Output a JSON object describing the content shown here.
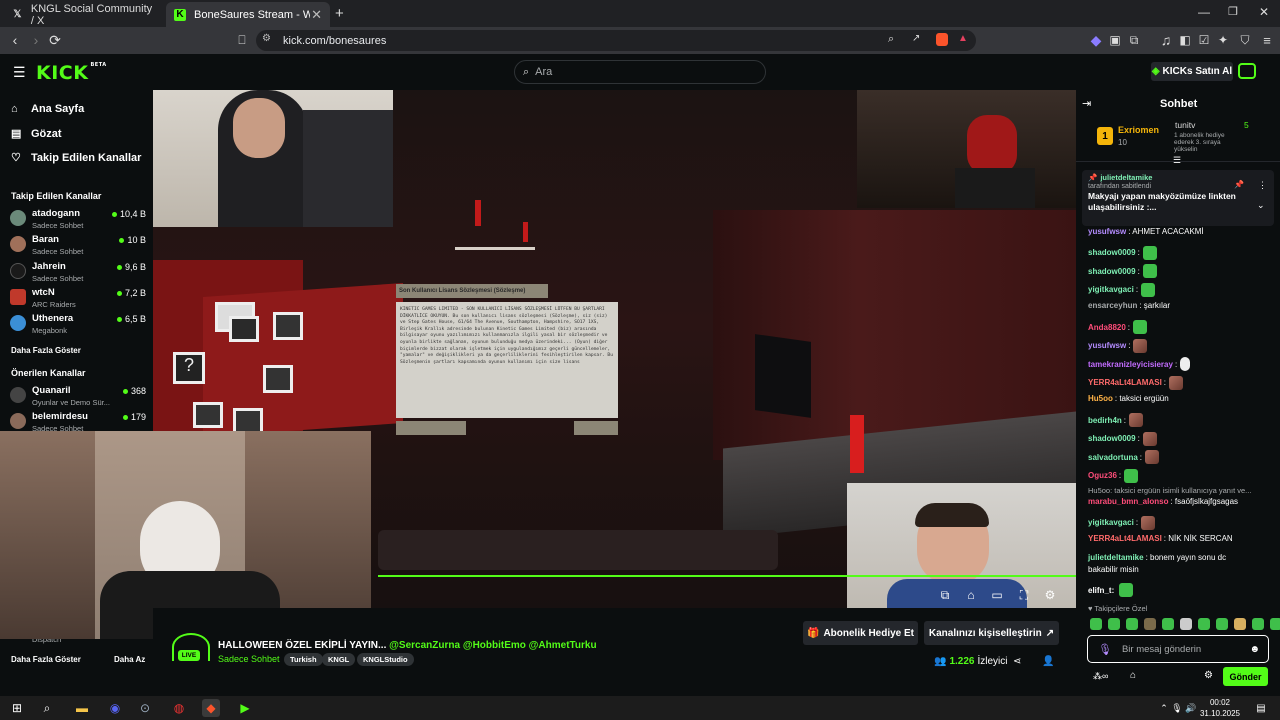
{
  "browser": {
    "tabs": [
      {
        "title": "KNGL Social Community / X",
        "icon": "x-logo-icon"
      },
      {
        "title": "BoneSaures Stream - Watch Live",
        "icon": "kick-logo-icon"
      }
    ],
    "url": "kick.com/bonesaures"
  },
  "header": {
    "logo": "KICK",
    "logo_badge": "BETA",
    "search_placeholder": "Ara",
    "buy_button": "KICKs Satın Al"
  },
  "sidebar": {
    "nav": [
      {
        "label": "Ana Sayfa",
        "icon": "home-icon"
      },
      {
        "label": "Gözat",
        "icon": "browse-icon"
      },
      {
        "label": "Takip Edilen Kanallar",
        "icon": "heart-icon"
      }
    ],
    "followed_title": "Takip Edilen Kanallar",
    "followed": [
      {
        "name": "atadogann",
        "sub": "Sadece Sohbet",
        "viewers": "10,4 B"
      },
      {
        "name": "Baran",
        "sub": "Sadece Sohbet",
        "viewers": "10 B"
      },
      {
        "name": "Jahrein",
        "sub": "Sadece Sohbet",
        "viewers": "9,6 B"
      },
      {
        "name": "wtcN",
        "sub": "ARC Raiders",
        "viewers": "7,2 B"
      },
      {
        "name": "Uthenera",
        "sub": "Megabonk",
        "viewers": "6,5 B"
      }
    ],
    "show_more": "Daha Fazla Göster",
    "recommended_title": "Önerilen Kanallar",
    "recommended": [
      {
        "name": "Quanaril",
        "sub": "Oyunlar ve Demo Sür...",
        "viewers": "368"
      },
      {
        "name": "belemirdesu",
        "sub": "Sadece Sohbet",
        "viewers": "179"
      }
    ],
    "partial_item": "Dispatch",
    "show_more_2": "Daha Fazla Göster",
    "show_less": "Daha Az"
  },
  "video": {
    "license_title": "Son Kullanıcı Lisans Sözleşmesi (Sözleşme)",
    "license_body": "KINETIC GAMES LIMITED - SON KULLANICI LİSANS SÖZLEŞMESİ LÜTFEN BU ŞARTLARI DİKKATLİCE OKUYUN. Bu son kullanıcı lisans sözleşmesi (Sözleşme), siz (siz) ve Step Gates House, 61/64 The Avenue, Southampton, Hampshire, SO17 1XS, Birleşik Krallık adresinde bulunan Kinetic Games Limited (biz) arasında bilgisayar oyunu yazılımımızı kullanmanızla ilgili yasal bir sözleşmedir ve oyunla birlikte sağlanan, oyunun bulunduğu medya üzerindeki... (Oyun) diğer biçimlerde bizzat olarak işletmek için uygulandığımız geçerli güncellemeler, \"yamalar\" ve değişiklikleri ya da geçerliliklerini fesihleştirilen kapsar. Bu Sözleşmenin şartları kapsamında oyunun kullanımı için size lisans"
  },
  "stream": {
    "title": "HALLOWEEN ÖZEL EKİPLİ YAYIN...",
    "mentions": "@SercanZurna @HobbitEmo @AhmetTurku",
    "category": "Sadece Sohbet",
    "tags": [
      "Turkish",
      "KNGL",
      "KNGLStudio"
    ],
    "live_badge": "LIVE",
    "gift_button": "Abonelik Hediye Et",
    "customize_button": "Kanalınızı kişiselleştirin",
    "viewers": "1.226",
    "viewers_label": "İzleyici"
  },
  "chat": {
    "title": "Sohbet",
    "gifter1": {
      "name": "Exriomen",
      "count": "10",
      "rank": "1"
    },
    "gifter2": {
      "name": "tunitv",
      "count": "5",
      "note": "1 abonelik hediye ederek 3. sıraya yükselin"
    },
    "pinned": {
      "user": "julietdeltamike",
      "by": "tarafından sabitlendi",
      "text": "Makyajı yapan makyözümüze linkten ulaşabilirsiniz :..."
    },
    "messages": [
      {
        "user": "yusufwsw",
        "color": "#b48cff",
        "text": ": AHMET ACACAKMİ",
        "emotes": []
      },
      {
        "user": "shadow0009",
        "color": "#7ff0b5",
        "text": ":",
        "emotes": [
          "green"
        ]
      },
      {
        "user": "shadow0009",
        "color": "#7ff0b5",
        "text": ":",
        "emotes": [
          "green"
        ]
      },
      {
        "user": "yigitkavgaci",
        "color": "#7ff0b5",
        "text": ":",
        "emotes": [
          "green"
        ]
      },
      {
        "user": "ensarceyhun",
        "color": "#a8abad",
        "text": ": şarkılar",
        "emotes": []
      },
      {
        "user": "Anda8820",
        "color": "#ff4d7a",
        "text": ":",
        "emotes": [
          "green"
        ]
      },
      {
        "user": "yusufwsw",
        "color": "#b48cff",
        "text": ":",
        "emotes": [
          "pic"
        ]
      },
      {
        "user": "tamekranizleyicisieray",
        "color": "#c36cff",
        "text": ":",
        "emotes": [
          "hand"
        ]
      },
      {
        "user": "YERR4aLt4LAMASI",
        "color": "#ff6b6b",
        "text": ":",
        "emotes": [
          "pic"
        ]
      },
      {
        "user": "Hu5oo",
        "color": "#ffb347",
        "text": ": taksici ergüün",
        "emotes": []
      },
      {
        "user": "bedirh4n",
        "color": "#7ff0b5",
        "text": ":",
        "emotes": [
          "pic"
        ]
      },
      {
        "user": "shadow0009",
        "color": "#7ff0b5",
        "text": ":",
        "emotes": [
          "pic"
        ]
      },
      {
        "user": "salvadortuna",
        "color": "#7ff0b5",
        "text": ":",
        "emotes": [
          "pic"
        ]
      },
      {
        "user": "Oguz36",
        "color": "#ff4d7a",
        "text": ":",
        "emotes": [
          "green"
        ]
      }
    ],
    "reply_note": "Hu5oo: taksici ergüün isimli kullanıcıya yanıt ve...",
    "messages2": [
      {
        "user": "marabu_bmn_alonso",
        "color": "#ff4d7a",
        "text": ": fsaöfjslkajfgsagas",
        "emotes": []
      },
      {
        "user": "yigitkavgaci",
        "color": "#7ff0b5",
        "text": ":",
        "emotes": [
          "pic"
        ]
      },
      {
        "user": "YERR4aLt4LAMASI",
        "color": "#ff6b6b",
        "text": ": NİK NİK SERCAN",
        "emotes": []
      },
      {
        "user": "julietdeltamike",
        "color": "#7ff0b5",
        "text": ": bonem yayın sonu dc",
        "emotes": []
      }
    ],
    "wrap_text": "bakabilir misin",
    "last_msg": {
      "user": "elifn_t",
      "color": "#ff4d7a"
    },
    "followers_only": "Takipçilere Özel",
    "input_placeholder": "Bir mesaj gönderin",
    "send_button": "Gönder"
  },
  "taskbar": {
    "time": "00:02",
    "date": "31.10.2025"
  },
  "colors": {
    "accent": "#53fc18",
    "bg": "#0b0e0f"
  }
}
